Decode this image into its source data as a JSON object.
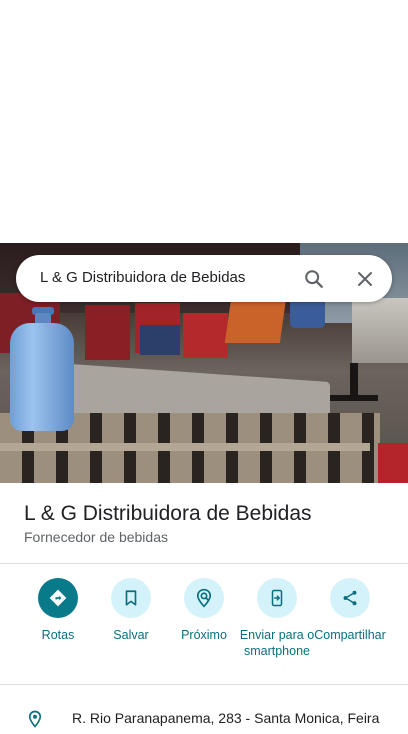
{
  "search": {
    "query": "L & G Distribuidora de Bebidas"
  },
  "place": {
    "name": "L & G Distribuidora de Bebidas",
    "category": "Fornecedor de bebidas"
  },
  "actions": [
    {
      "label": "Rotas",
      "icon": "directions-icon"
    },
    {
      "label": "Salvar",
      "icon": "bookmark-icon"
    },
    {
      "label": "Próximo",
      "icon": "nearby-icon"
    },
    {
      "label": "Enviar para o smartphone",
      "icon": "send-to-phone-icon"
    },
    {
      "label": "Compartilhar",
      "icon": "share-icon"
    }
  ],
  "address": {
    "text": "R. Rio Paranapanema, 283 - Santa Monica, Feira",
    "icon": "location-pin-icon"
  },
  "colors": {
    "accent": "#097a8a",
    "accent_light": "#d3f2fa",
    "label": "#0b6f7d"
  }
}
